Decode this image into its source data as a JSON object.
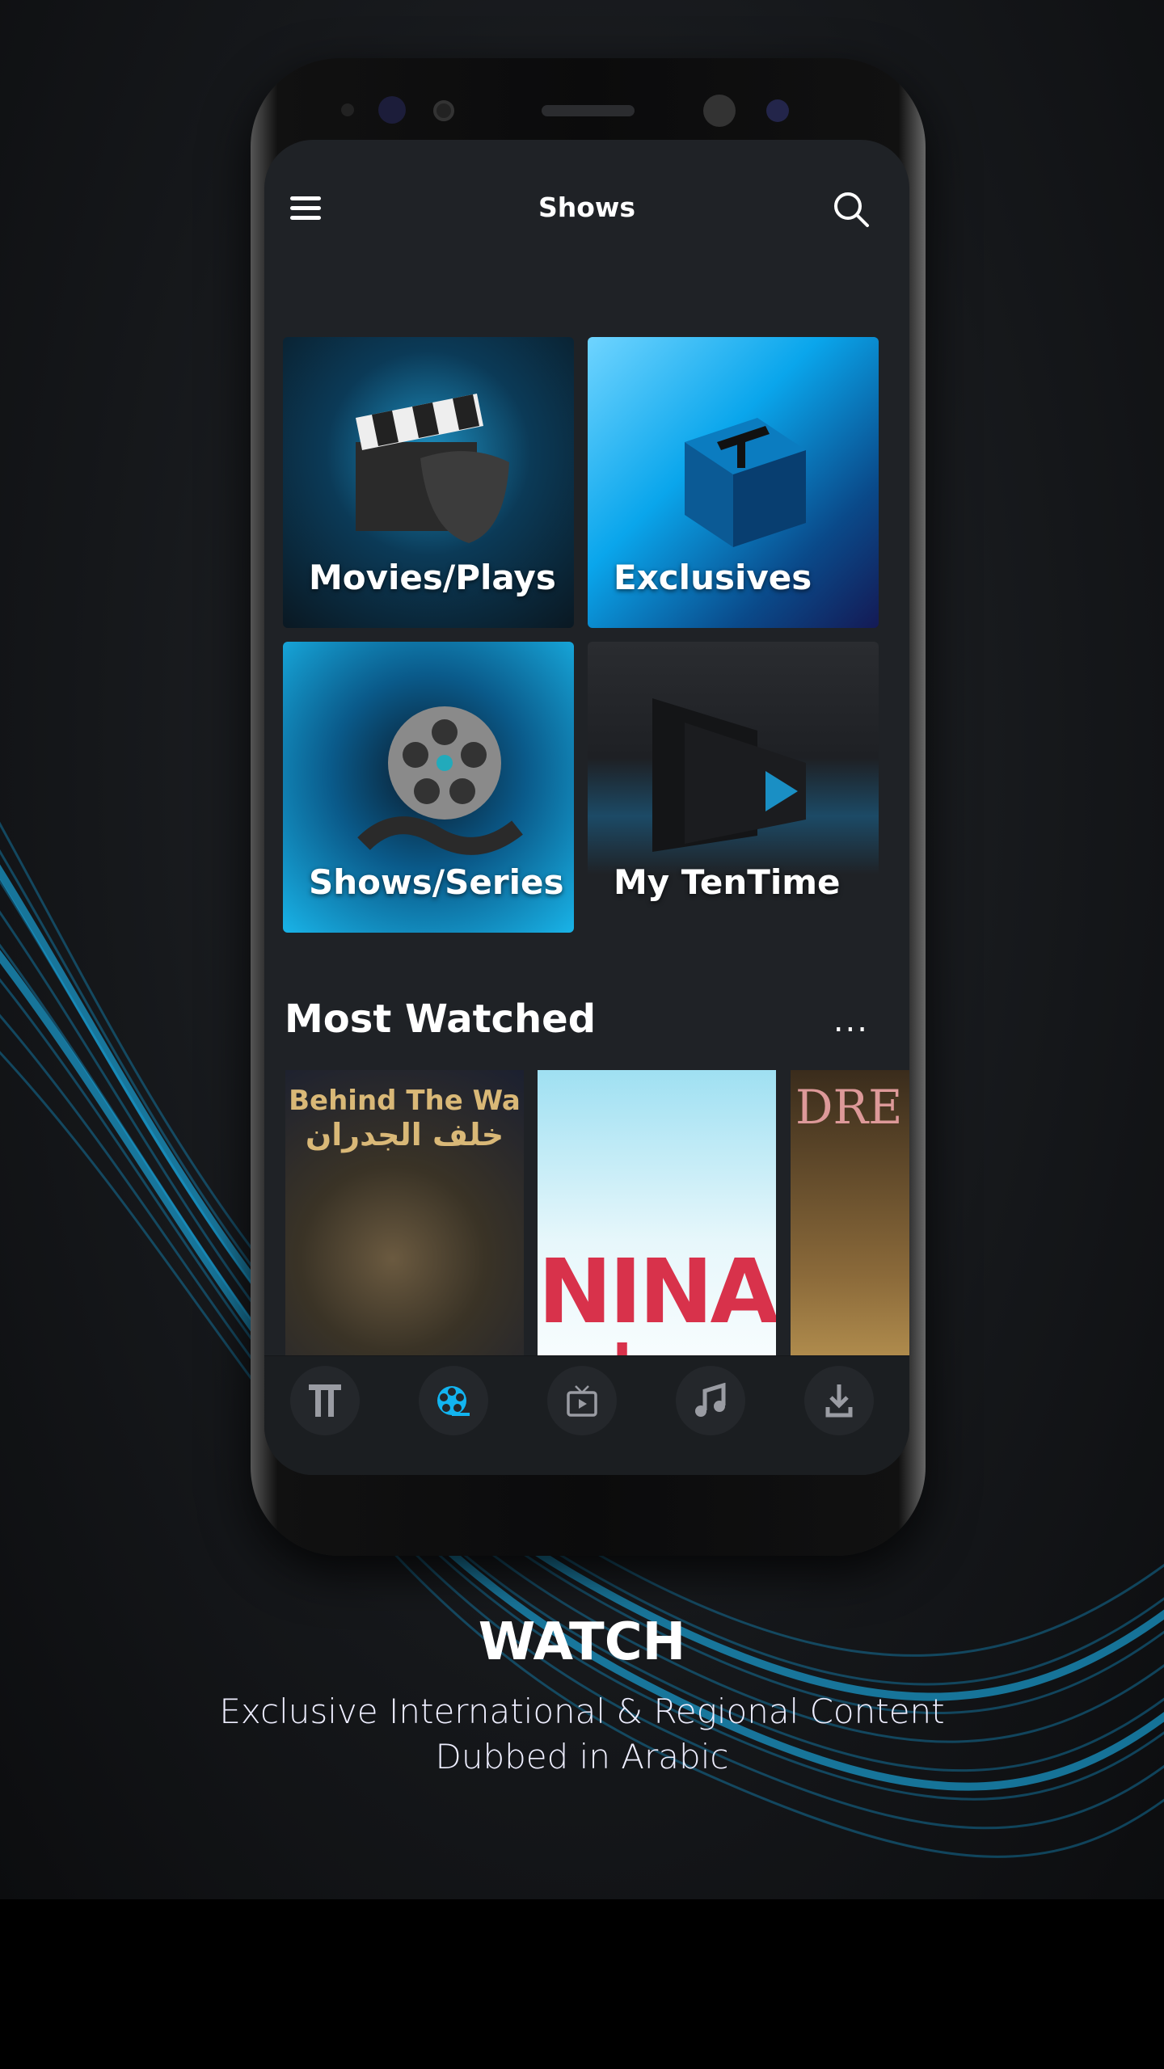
{
  "header": {
    "title": "Shows",
    "menu_icon": "hamburger-menu-icon",
    "search_icon": "search-icon"
  },
  "categories": [
    {
      "label": "Movies/Plays"
    },
    {
      "label": "Exclusives"
    },
    {
      "label": "Shows/Series"
    },
    {
      "label": "My TenTime"
    }
  ],
  "most_watched": {
    "title": "Most Watched",
    "more_label": "...",
    "posters": [
      {
        "title": "Behind The Wa",
        "subtitle": "خلف الجدران"
      },
      {
        "title": "NINA",
        "subtitle": "نينا"
      },
      {
        "title": "DRE",
        "subtitle": ""
      }
    ]
  },
  "bottom_nav": [
    {
      "icon": "tentime-logo-icon",
      "active": false
    },
    {
      "icon": "film-reel-icon",
      "active": true
    },
    {
      "icon": "tv-icon",
      "active": false
    },
    {
      "icon": "music-note-icon",
      "active": false
    },
    {
      "icon": "download-icon",
      "active": false
    }
  ],
  "caption": {
    "title": "WATCH",
    "line1": "Exclusive International & Regional Content",
    "line2": "Dubbed in Arabic"
  },
  "colors": {
    "accent": "#12b4f0",
    "screen_bg": "#1f2226",
    "icon_inactive": "#9a9ca3"
  }
}
